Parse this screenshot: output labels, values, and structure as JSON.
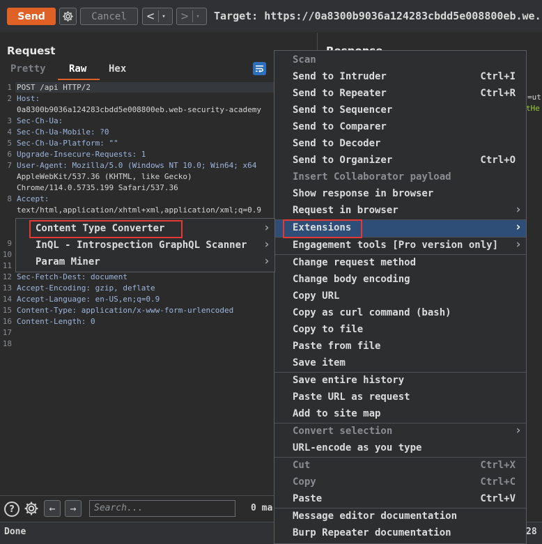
{
  "toolbar": {
    "send_label": "Send",
    "cancel_label": "Cancel",
    "back_arrow": "<",
    "forward_arrow": ">",
    "dropdown_glyph": "▾",
    "target_text": "Target: https://0a8300b9036a124283cbdd5e008800eb.we."
  },
  "request": {
    "title": "Request",
    "tabs": [
      "Pretty",
      "Raw",
      "Hex"
    ],
    "active_tab": "Raw",
    "lines": [
      {
        "n": "1",
        "text": "POST /api HTTP/2"
      },
      {
        "n": "2",
        "key": "Host",
        "text": "Host:"
      },
      {
        "n": "",
        "text": "0a8300b9036a124283cbdd5e008800eb.web-security-academy"
      },
      {
        "n": "3",
        "key": "Sec-Ch-Ua",
        "text": "Sec-Ch-Ua:"
      },
      {
        "n": "4",
        "key": "Sec-Ch-Ua-Mobile",
        "text": "Sec-Ch-Ua-Mobile: ?0"
      },
      {
        "n": "5",
        "key": "Sec-Ch-Ua-Platform",
        "text": "Sec-Ch-Ua-Platform: \"\""
      },
      {
        "n": "6",
        "key": "Upgrade-Insecure-Requests",
        "text": "Upgrade-Insecure-Requests: 1"
      },
      {
        "n": "7",
        "key": "User-Agent",
        "text": "User-Agent: Mozilla/5.0 (Windows NT 10.0; Win64; x64"
      },
      {
        "n": "",
        "text": "AppleWebKit/537.36 (KHTML, like Gecko)"
      },
      {
        "n": "",
        "text": "Chrome/114.0.5735.199 Safari/537.36"
      },
      {
        "n": "8",
        "key": "Accept",
        "text": "Accept:"
      },
      {
        "n": "",
        "text": "text/html,application/xhtml+xml,application/xml;q=0.9"
      },
      {
        "n": "9",
        "text": ""
      },
      {
        "n": "10",
        "text": ""
      },
      {
        "n": "11",
        "text": ""
      },
      {
        "n": "12",
        "key": "Sec-Fetch-Dest",
        "text": "Sec-Fetch-Dest: document"
      },
      {
        "n": "13",
        "key": "Accept-Encoding",
        "text": "Accept-Encoding: gzip, deflate"
      },
      {
        "n": "14",
        "key": "Accept-Language",
        "text": "Accept-Language: en-US,en;q=0.9"
      },
      {
        "n": "15",
        "key": "Content-Type",
        "text": "Content-Type: application/x-www-form-urlencoded"
      },
      {
        "n": "16",
        "key": "Content-Length",
        "text": "Content-Length: 0"
      },
      {
        "n": "17",
        "text": ""
      },
      {
        "n": "18",
        "text": ""
      }
    ]
  },
  "response": {
    "title": "Response",
    "peek_1": "=ut",
    "peek_2": "tHe"
  },
  "bottom": {
    "search_placeholder": "Search...",
    "matches": "0 ma",
    "status": "Done",
    "status_right": "28"
  },
  "context_menu": {
    "items": [
      {
        "label": "Scan",
        "disabled": true
      },
      {
        "label": "Send to Intruder",
        "shortcut": "Ctrl+I"
      },
      {
        "label": "Send to Repeater",
        "shortcut": "Ctrl+R"
      },
      {
        "label": "Send to Sequencer"
      },
      {
        "label": "Send to Comparer"
      },
      {
        "label": "Send to Decoder"
      },
      {
        "label": "Send to Organizer",
        "shortcut": "Ctrl+O"
      },
      {
        "label": "Insert Collaborator payload",
        "disabled": true
      },
      {
        "label": "Show response in browser"
      },
      {
        "label": "Request in browser",
        "submenu": true
      },
      {
        "label": "Extensions",
        "submenu": true,
        "selected": true
      },
      {
        "label": "Engagement tools [Pro version only]",
        "submenu": true
      },
      {
        "label": "Change request method"
      },
      {
        "label": "Change body encoding"
      },
      {
        "label": "Copy URL"
      },
      {
        "label": "Copy as curl command (bash)"
      },
      {
        "label": "Copy to file"
      },
      {
        "label": "Paste from file"
      },
      {
        "label": "Save item"
      },
      {
        "label": "Save entire history"
      },
      {
        "label": "Paste URL as request"
      },
      {
        "label": "Add to site map"
      },
      {
        "label": "Convert selection",
        "disabled": true,
        "submenu": true
      },
      {
        "label": "URL-encode as you type"
      },
      {
        "label": "Cut",
        "shortcut": "Ctrl+X",
        "disabled": true
      },
      {
        "label": "Copy",
        "shortcut": "Ctrl+C",
        "disabled": true
      },
      {
        "label": "Paste",
        "shortcut": "Ctrl+V"
      },
      {
        "label": "Message editor documentation"
      },
      {
        "label": "Burp Repeater documentation"
      }
    ]
  },
  "extensions_submenu": {
    "items": [
      {
        "label": "Content Type Converter",
        "highlighted": true
      },
      {
        "label": "InQL - Introspection GraphQL Scanner"
      },
      {
        "label": "Param Miner"
      }
    ]
  },
  "colors": {
    "accent": "#e06126",
    "selection": "#2e4e77",
    "highlight_box": "#e53935",
    "background": "#2b2b2b"
  }
}
